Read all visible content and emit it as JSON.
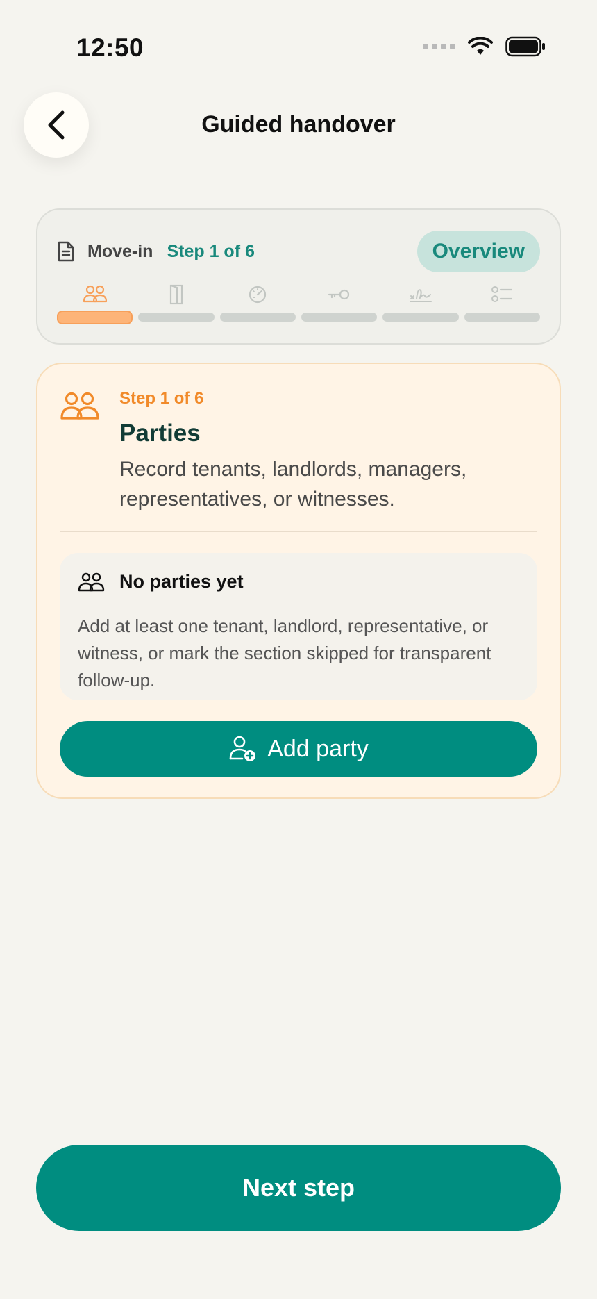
{
  "status_bar": {
    "time": "12:50"
  },
  "header": {
    "title": "Guided handover"
  },
  "progress": {
    "flow_label": "Move-in",
    "step_text": "Step 1 of 6",
    "overview_label": "Overview",
    "current_step": 1,
    "total_steps": 6,
    "steps": [
      {
        "icon": "people-icon",
        "active": true
      },
      {
        "icon": "door-icon",
        "active": false
      },
      {
        "icon": "meter-icon",
        "active": false
      },
      {
        "icon": "key-icon",
        "active": false
      },
      {
        "icon": "signature-icon",
        "active": false
      },
      {
        "icon": "checklist-icon",
        "active": false
      }
    ]
  },
  "section": {
    "step_text": "Step 1 of 6",
    "title": "Parties",
    "description": "Record tenants, landlords, managers, representatives, or witnesses.",
    "empty_state": {
      "title": "No parties yet",
      "body": "Add at least one tenant, landlord, representative, or witness, or mark the section skipped for transparent follow-up."
    },
    "add_button_label": "Add party"
  },
  "footer": {
    "next_label": "Next step"
  },
  "colors": {
    "accent": "#008d80",
    "accent_light": "#c7e3dc",
    "orange": "#f18a2a",
    "card_bg": "#fff4e6"
  }
}
